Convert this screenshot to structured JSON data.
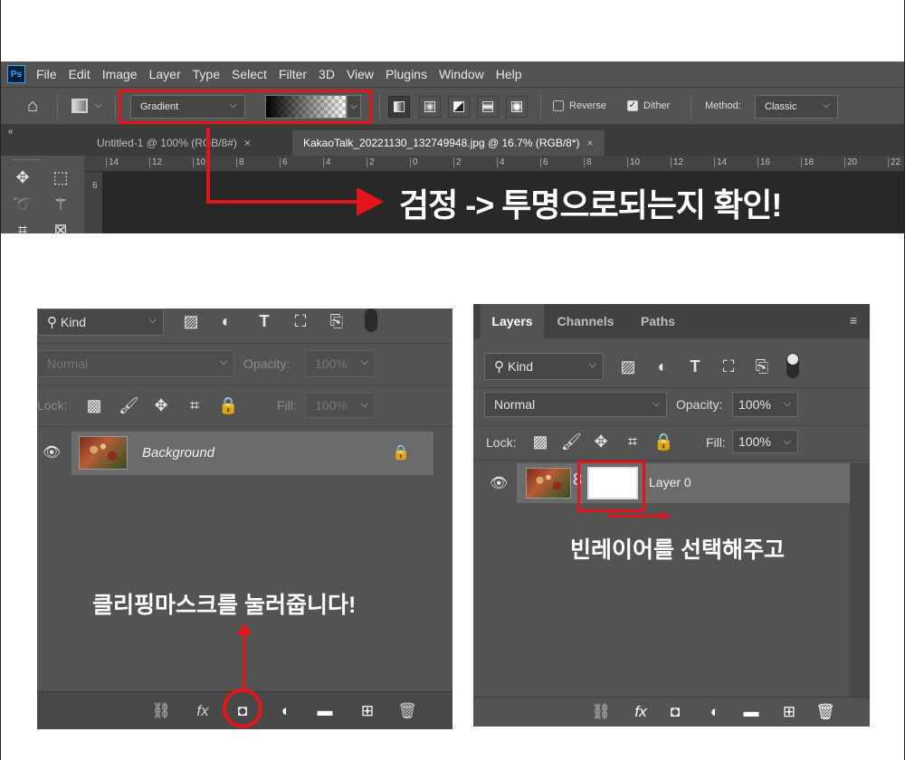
{
  "menubar": {
    "logo": "Ps",
    "items": [
      "File",
      "Edit",
      "Image",
      "Layer",
      "Type",
      "Select",
      "Filter",
      "3D",
      "View",
      "Plugins",
      "Window",
      "Help"
    ]
  },
  "options": {
    "preset_label": "Gradient",
    "reverse_label": "Reverse",
    "dither_label": "Dither",
    "method_label": "Method:",
    "method_value": "Classic",
    "reverse_checked": false,
    "dither_checked": true
  },
  "tabs": [
    {
      "title": "Untitled-1 @ 100% (RGB/8#)",
      "close": "×"
    },
    {
      "title": "KakaoTalk_20221130_132749948.jpg @ 16.7% (RGB/8*)",
      "close": "×"
    }
  ],
  "ruler": {
    "ticks": [
      "14",
      "12",
      "10",
      "8",
      "6",
      "4",
      "2",
      "0",
      "2",
      "4",
      "6",
      "8",
      "10",
      "12",
      "14",
      "16",
      "18",
      "20",
      "22"
    ],
    "v_ticks": [
      "6"
    ]
  },
  "annotations": {
    "top": "검정 -> 투명으로되는지 확인!",
    "left": "클리핑마스크를 눌러줍니다!",
    "right": "빈레이어를 선택해주고"
  },
  "left_panel": {
    "kind_label": "Kind",
    "blend_mode": "Normal",
    "opacity_label": "Opacity:",
    "opacity_value": "100%",
    "lock_label": "Lock:",
    "fill_label": "Fill:",
    "fill_value": "100%",
    "layer_name": "Background"
  },
  "right_panel": {
    "tabs": [
      "Layers",
      "Channels",
      "Paths"
    ],
    "kind_label": "Kind",
    "blend_mode": "Normal",
    "opacity_label": "Opacity:",
    "opacity_value": "100%",
    "lock_label": "Lock:",
    "fill_label": "Fill:",
    "fill_value": "100%",
    "layer_name": "Layer 0"
  },
  "colors": {
    "highlight_red": "#e5141b",
    "panel_bg": "#535353",
    "ps_blue": "#31a8ff"
  },
  "icons": {
    "bottom_bar": [
      "link-icon",
      "fx-icon",
      "layer-mask-icon",
      "adjustment-icon",
      "folder-icon",
      "new-layer-icon",
      "trash-icon"
    ],
    "bottom_glyphs": [
      "⛓",
      "fx",
      "◘",
      "◐",
      "▬",
      "⊞",
      "🗑"
    ]
  }
}
